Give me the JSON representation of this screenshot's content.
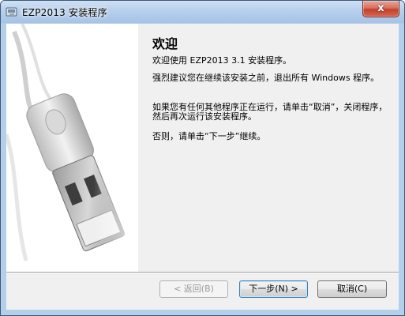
{
  "window": {
    "title": "EZP2013 安装程序",
    "close_label": "x"
  },
  "welcome": {
    "heading": "欢迎",
    "paragraphs": [
      "欢迎使用 EZP2013 3.1 安装程序。",
      "强烈建议您在继续该安装之前，退出所有 Windows 程序。",
      "如果您有任何其他程序正在运行，请单击“取消”，关闭程序，然后再次运行该安装程序。",
      "否则，请单击“下一步”继续。"
    ]
  },
  "buttons": {
    "back": "< 返回(B)",
    "next": "下一步(N) >",
    "cancel": "取消(C)"
  },
  "colors": {
    "close_button": "#c4402b",
    "titlebar": "#b7d0ec",
    "dialog_bg": "#f0f0f0"
  }
}
